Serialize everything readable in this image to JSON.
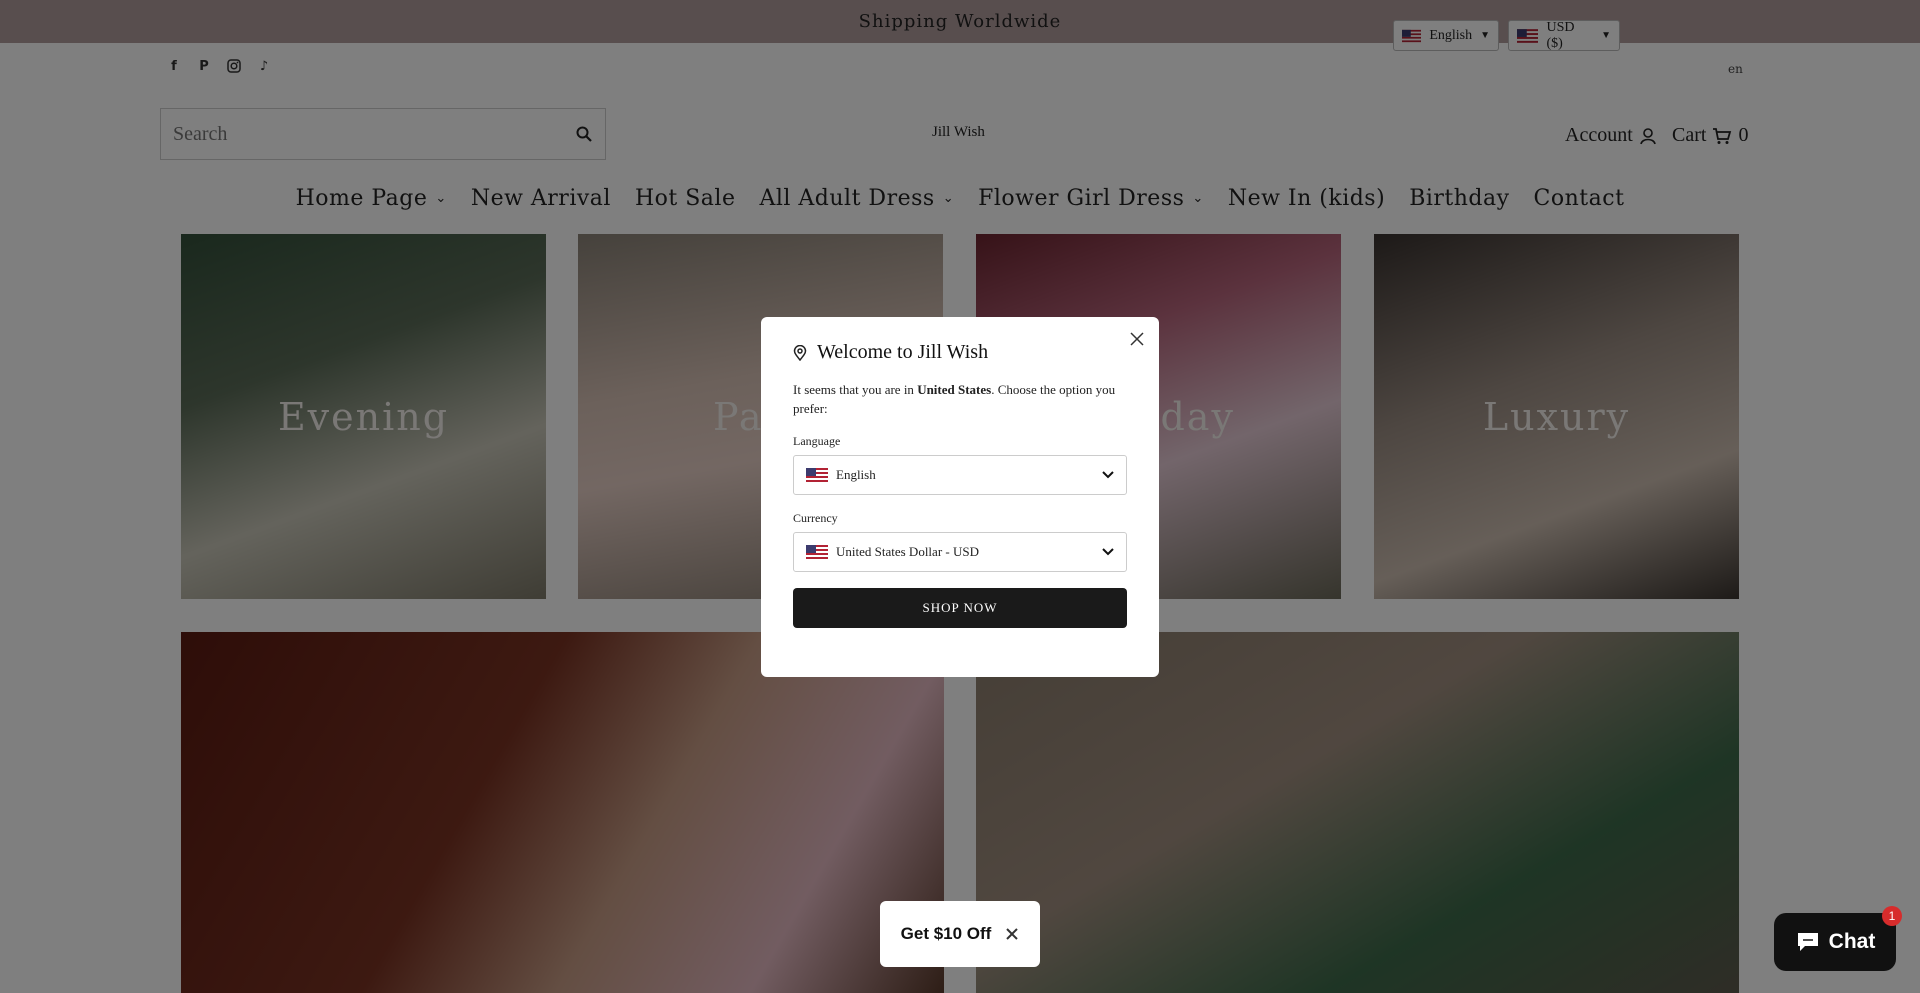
{
  "announcement": "Shipping Worldwide",
  "topbar": {
    "language_select": "English",
    "currency_select": "USD ($)",
    "lang_code": "en"
  },
  "social": {
    "icons": [
      "facebook-icon",
      "pinterest-icon",
      "instagram-icon",
      "tiktok-icon"
    ]
  },
  "search": {
    "placeholder": "Search"
  },
  "logo": "Jill Wish",
  "header": {
    "account": "Account",
    "cart": "Cart",
    "cart_count": "0"
  },
  "nav": {
    "items": [
      {
        "label": "Home Page",
        "dropdown": true
      },
      {
        "label": "New Arrival",
        "dropdown": false
      },
      {
        "label": "Hot Sale",
        "dropdown": false
      },
      {
        "label": "All Adult Dress",
        "dropdown": true
      },
      {
        "label": "Flower Girl Dress",
        "dropdown": true
      },
      {
        "label": "New In (kids)",
        "dropdown": false
      },
      {
        "label": "Birthday",
        "dropdown": false
      },
      {
        "label": "Contact",
        "dropdown": false
      }
    ]
  },
  "tiles": {
    "evening": "Evening",
    "party": "Pa",
    "sunday": "nday",
    "luxury": "Luxury"
  },
  "modal": {
    "title": "Welcome to Jill Wish",
    "msg_prefix": "It seems that you are in ",
    "msg_country": "United States",
    "msg_suffix": ". Choose the option you prefer:",
    "language_label": "Language",
    "language_value": "English",
    "currency_label": "Currency",
    "currency_value": "United States Dollar - USD",
    "button": "SHOP NOW"
  },
  "promo": {
    "label": "Get $10 Off"
  },
  "chat": {
    "label": "Chat",
    "badge": "1"
  },
  "colors": {
    "announcement_bg": "#b09c9c",
    "modal_button": "#1a1a1a",
    "chat_badge": "#d72c2c"
  }
}
